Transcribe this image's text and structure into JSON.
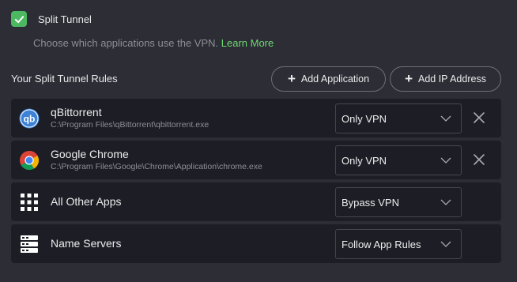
{
  "split_tunnel": {
    "label": "Split Tunnel",
    "checked": true,
    "description": "Choose which applications use the VPN.",
    "learn_more": "Learn More"
  },
  "rules_section": {
    "title": "Your Split Tunnel Rules",
    "add_application": "Add Application",
    "add_ip": "Add IP Address"
  },
  "rules": [
    {
      "name": "qBittorrent",
      "path": "C:\\Program Files\\qBittorrent\\qbittorrent.exe",
      "mode": "Only VPN",
      "icon": "qbittorrent-icon"
    },
    {
      "name": "Google Chrome",
      "path": "C:\\Program Files\\Google\\Chrome\\Application\\chrome.exe",
      "mode": "Only VPN",
      "icon": "chrome-icon"
    },
    {
      "name": "All Other Apps",
      "mode": "Bypass VPN",
      "icon": "grid-icon"
    },
    {
      "name": "Name Servers",
      "mode": "Follow App Rules",
      "icon": "server-icon"
    }
  ],
  "colors": {
    "background": "#2c2d35",
    "row": "#1d1e25",
    "accent_green": "#4cb861",
    "link_green": "#6fd873"
  }
}
